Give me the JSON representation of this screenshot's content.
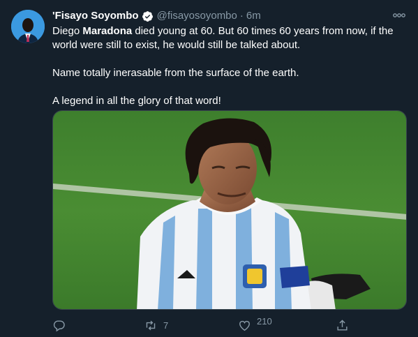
{
  "author": {
    "display_name": "'Fisayo Soyombo",
    "handle": "@fisayosoyombo",
    "time_sep": "·",
    "time": "6m"
  },
  "tweet": {
    "line1_before": "Diego ",
    "line1_bold": "Maradona",
    "line1_after": " died young at 60. But 60 times 60 years from now, if the world were still to exist, he would still be talked about.",
    "paragraph2": "Name totally inerasable from the surface of the earth.",
    "paragraph3": "A legend in all the glory of that word!"
  },
  "stats": {
    "retweets": "7",
    "likes": "210"
  },
  "colors": {
    "background": "#15202b",
    "text": "#ffffff",
    "muted": "#8899a6",
    "verified": "#ffffff"
  },
  "icons": {
    "verified": "verified-badge-icon",
    "more": "more-icon",
    "reply": "reply-icon",
    "retweet": "retweet-icon",
    "like": "heart-icon",
    "share": "share-icon"
  }
}
